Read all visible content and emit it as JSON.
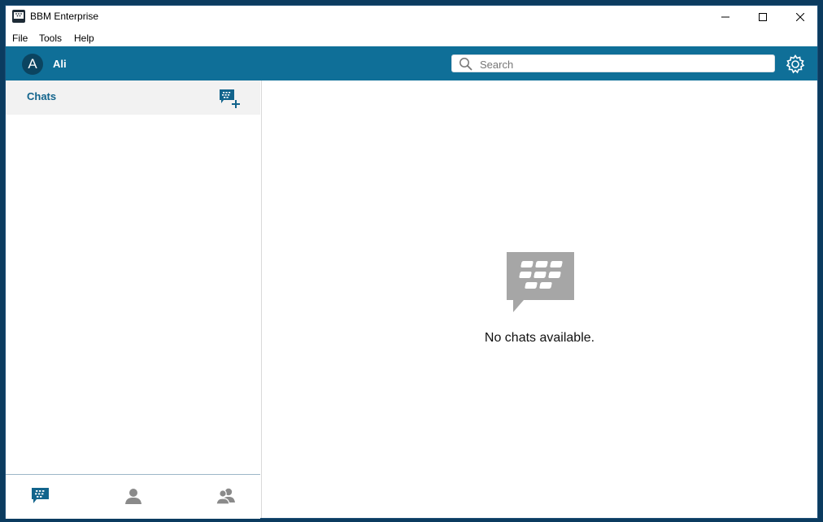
{
  "window": {
    "title": "BBM Enterprise"
  },
  "menu": {
    "items": [
      "File",
      "Tools",
      "Help"
    ]
  },
  "header": {
    "avatar_initial": "A",
    "username": "Ali",
    "search_placeholder": "Search",
    "accent_color": "#0f6f98"
  },
  "sidebar": {
    "section_title": "Chats",
    "nav": [
      "chats-icon",
      "contacts-icon",
      "groups-icon"
    ]
  },
  "main": {
    "empty_message": "No chats available."
  }
}
